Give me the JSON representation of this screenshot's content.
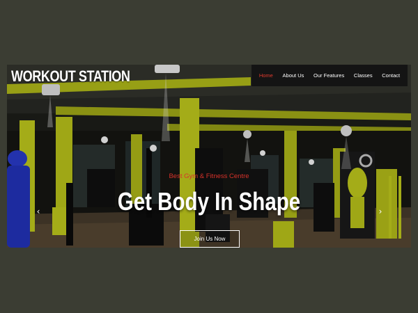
{
  "site": {
    "logo": "WORKOUT STATION"
  },
  "nav": {
    "items": [
      {
        "label": "Home",
        "active": true
      },
      {
        "label": "About Us",
        "active": false
      },
      {
        "label": "Our Features",
        "active": false
      },
      {
        "label": "Classes",
        "active": false
      },
      {
        "label": "Contact",
        "active": false
      }
    ]
  },
  "hero": {
    "tagline": "Best Gym & Fitness Centre",
    "headline": "Get Body In Shape",
    "cta_label": "Join Us Now",
    "prev_icon": "chevron-left-icon",
    "next_icon": "chevron-right-icon"
  },
  "colors": {
    "page_background": "#3b3d33",
    "accent_red": "#e23b2e",
    "pillar_yellow": "#c8d21e",
    "nav_background": "#141414"
  }
}
